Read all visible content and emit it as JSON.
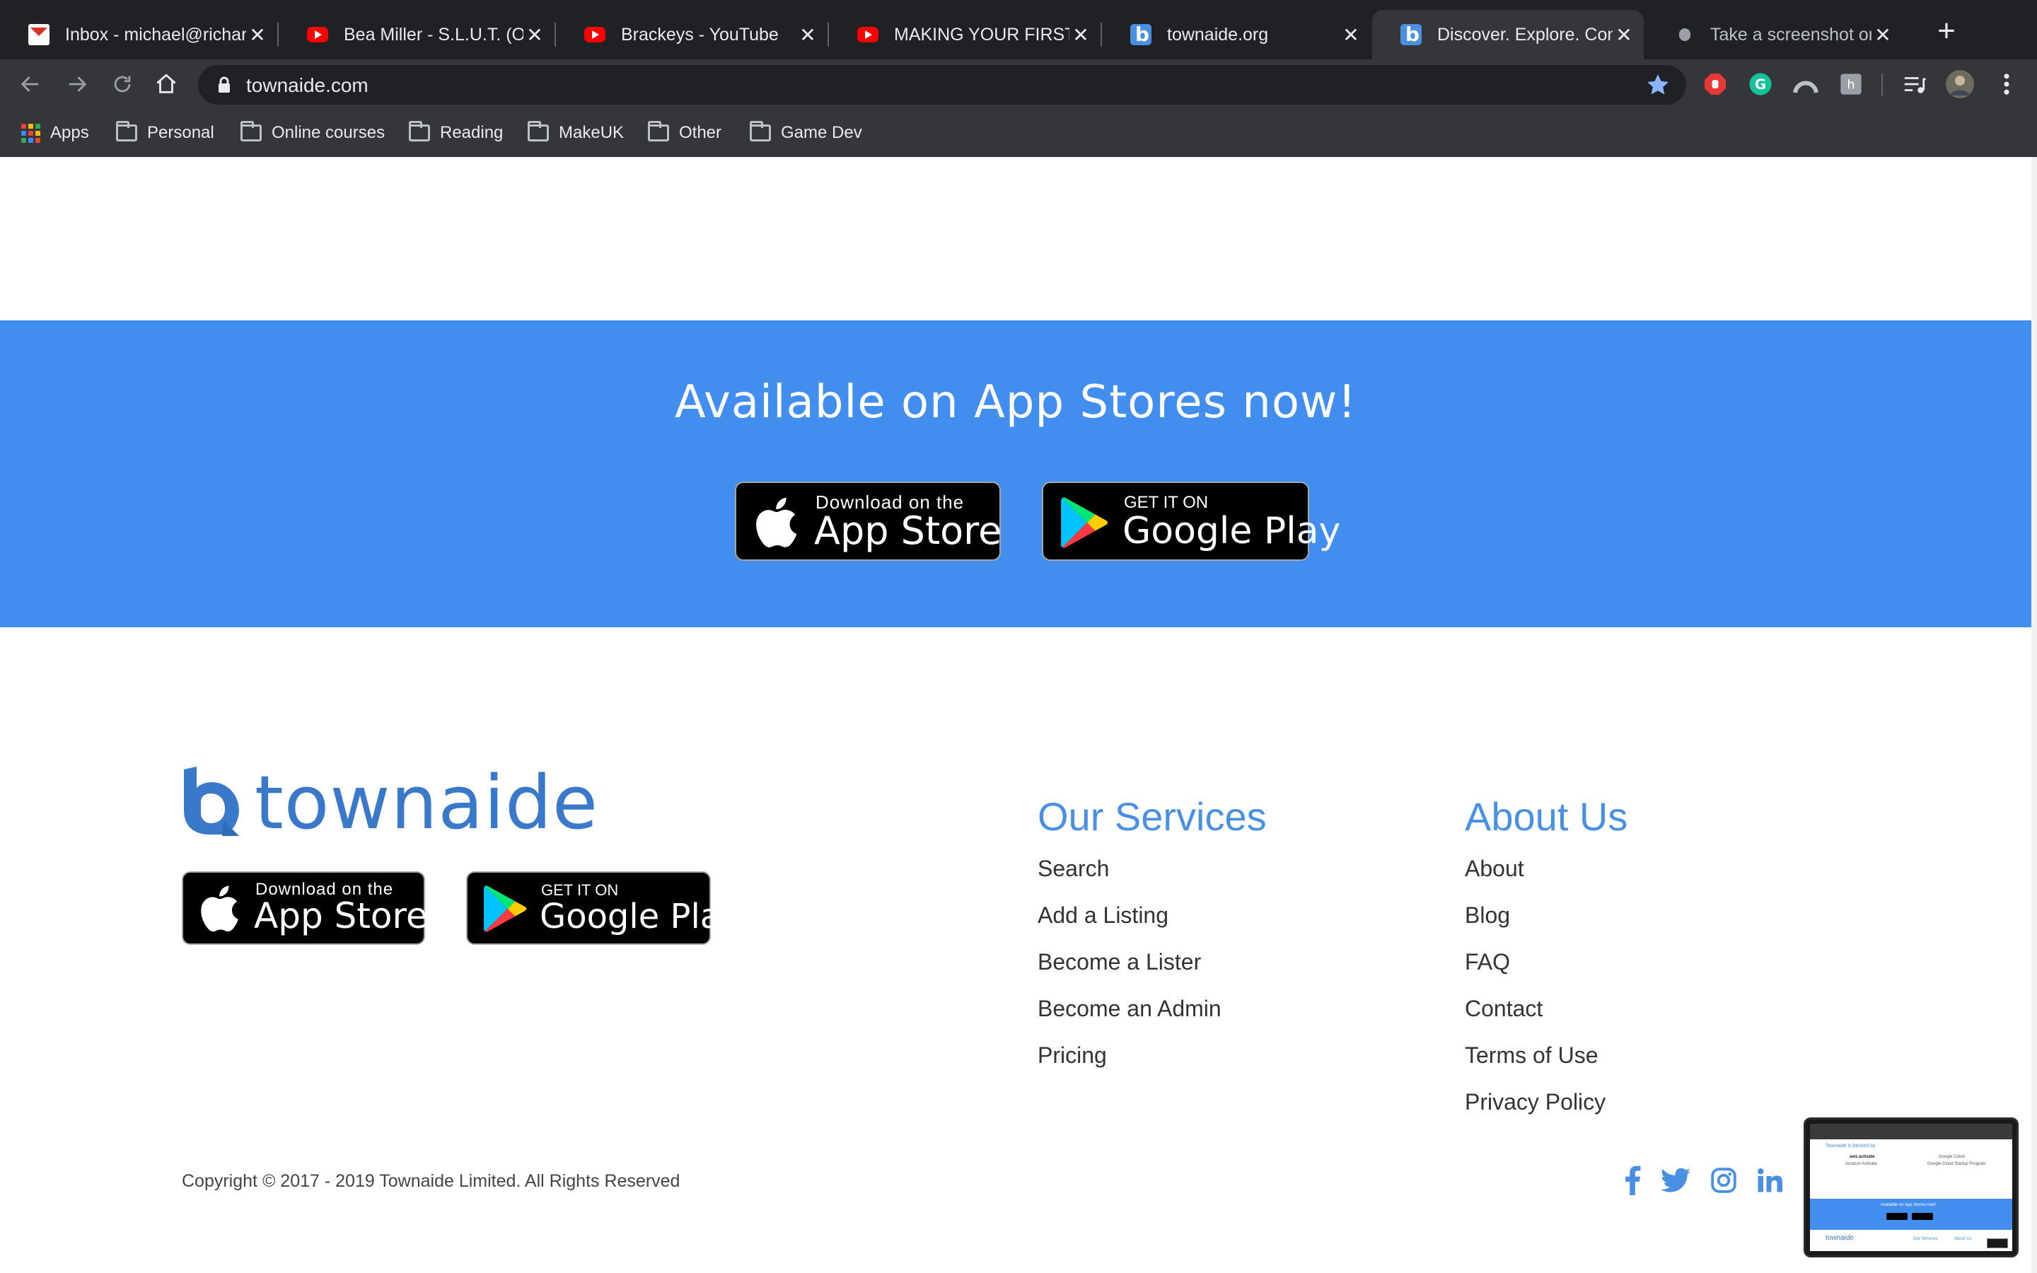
{
  "browser": {
    "tabs": [
      {
        "title": "Inbox - michael@richardsonenterprise",
        "favicon": "gmail-icon",
        "active": false
      },
      {
        "title": "Bea Miller - S.L.U.T. (Official",
        "favicon": "youtube-icon",
        "active": false
      },
      {
        "title": "Brackeys - YouTube",
        "favicon": "youtube-icon",
        "active": false
      },
      {
        "title": "MAKING YOUR FIRST LEVEL",
        "favicon": "youtube-icon",
        "active": false
      },
      {
        "title": "townaide.org",
        "favicon": "townaide-icon",
        "active": false
      },
      {
        "title": "Discover. Explore. Connect.",
        "favicon": "townaide-icon",
        "active": true
      },
      {
        "title": "Take a screenshot on your Mac",
        "favicon": "apple-icon",
        "active": false
      }
    ],
    "close_glyph": "✕",
    "new_tab_glyph": "+",
    "url": "townaide.com",
    "bookmarks": [
      {
        "label": "Apps",
        "icon": "apps-grid-icon"
      },
      {
        "label": "Personal",
        "icon": "folder-icon"
      },
      {
        "label": "Online courses",
        "icon": "folder-icon"
      },
      {
        "label": "Reading",
        "icon": "folder-icon"
      },
      {
        "label": "MakeUK",
        "icon": "folder-icon"
      },
      {
        "label": "Other",
        "icon": "folder-icon"
      },
      {
        "label": "Game Dev",
        "icon": "folder-icon"
      }
    ],
    "colors": {
      "tabstrip": "#202124",
      "toolbar": "#35363a",
      "star": "#8ab4f8"
    }
  },
  "hero": {
    "title": "Available on App Stores now!",
    "background": "#428eef"
  },
  "badges": {
    "appstore_small": "Download on the",
    "appstore_big": "App Store",
    "googleplay_small": "GET IT ON",
    "googleplay_big": "Google Play"
  },
  "footer": {
    "logo_text": "townaide",
    "logo_color": "#3a78c9",
    "services": {
      "title": "Our Services",
      "links": [
        "Search",
        "Add a Listing",
        "Become a Lister",
        "Become an Admin",
        "Pricing"
      ]
    },
    "about": {
      "title": "About Us",
      "links": [
        "About",
        "Blog",
        "FAQ",
        "Contact",
        "Terms of Use",
        "Privacy Policy"
      ]
    },
    "copyright": "Copyright © 2017 - 2019 Townaide Limited. All Rights Reserved",
    "socials": [
      "facebook-icon",
      "twitter-icon",
      "instagram-icon",
      "linkedin-icon"
    ],
    "accent": "#4a90e2"
  },
  "thumbnail": {
    "backed_by": "Townaide is backed by",
    "sponsor_1": "aws activate",
    "sponsor_1_caption": "Amazon Activate",
    "sponsor_2": "Google Cloud",
    "sponsor_2_caption": "Google Cloud Startup Program",
    "band_text": "Available on App Stores now!",
    "logo_text": "townaide",
    "services_text": "Our Services",
    "about_text": "About Us"
  }
}
